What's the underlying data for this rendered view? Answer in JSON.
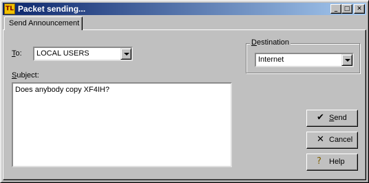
{
  "window": {
    "title": "Packet sending...",
    "icon_text": "TL",
    "controls": {
      "minimize": "_",
      "maximize": "□",
      "close": "✕"
    }
  },
  "tabs": [
    {
      "label": "Send Announcement",
      "selected": true
    }
  ],
  "form": {
    "to_label_u": "T",
    "to_label_rest": "o:",
    "to_value": "LOCAL USERS",
    "subject_label_u": "S",
    "subject_label_rest": "ubject:",
    "subject_value": "Does anybody copy XF4IH?",
    "destination_label_u": "D",
    "destination_label_rest": "estination",
    "destination_value": "Internet"
  },
  "buttons": {
    "send": {
      "u": "S",
      "rest": "end",
      "icon": "✔"
    },
    "cancel": {
      "label": "Cancel",
      "icon": "✕"
    },
    "help": {
      "label": "Help",
      "icon": "?"
    }
  }
}
